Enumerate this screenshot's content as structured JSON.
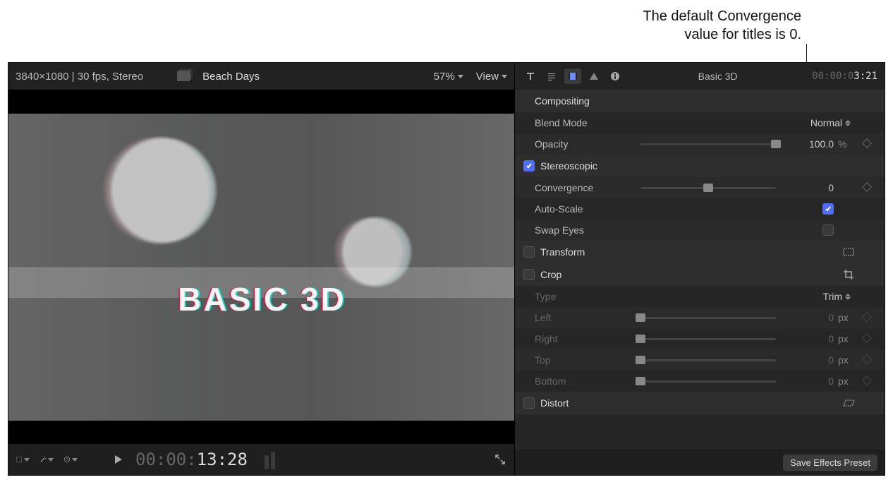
{
  "annotation": {
    "line1": "The default Convergence",
    "line2": "value for titles is 0."
  },
  "viewer": {
    "info": "3840×1080 | 30 fps, Stereo",
    "clipTitle": "Beach Days",
    "zoom": "57%",
    "viewLabel": "View",
    "overlayTitle": "BASIC 3D",
    "timecode_dim": "00:00:",
    "timecode_bright": "13:28"
  },
  "inspector": {
    "title": "Basic 3D",
    "time_dim": "00:00:0",
    "time_bright": "3:21",
    "sections": {
      "compositing": "Compositing",
      "stereoscopic": "Stereoscopic",
      "transform": "Transform",
      "crop": "Crop",
      "distort": "Distort"
    },
    "blendMode": {
      "label": "Blend Mode",
      "value": "Normal"
    },
    "opacity": {
      "label": "Opacity",
      "value": "100.0",
      "unit": "%",
      "thumbPct": 100
    },
    "convergence": {
      "label": "Convergence",
      "value": "0",
      "thumbPct": 50
    },
    "autoScale": {
      "label": "Auto-Scale",
      "checked": true
    },
    "swapEyes": {
      "label": "Swap Eyes",
      "checked": false
    },
    "crop": {
      "type": {
        "label": "Type",
        "value": "Trim"
      },
      "left": {
        "label": "Left",
        "value": "0",
        "unit": "px"
      },
      "right": {
        "label": "Right",
        "value": "0",
        "unit": "px"
      },
      "top": {
        "label": "Top",
        "value": "0",
        "unit": "px"
      },
      "bottom": {
        "label": "Bottom",
        "value": "0",
        "unit": "px"
      }
    },
    "savePreset": "Save Effects Preset"
  }
}
